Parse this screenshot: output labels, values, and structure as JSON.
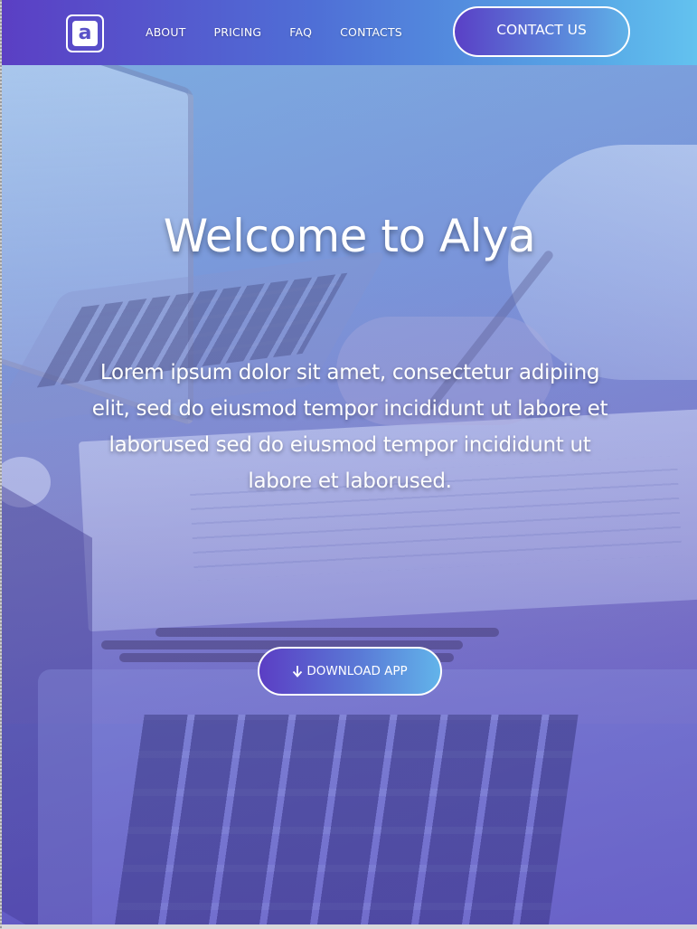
{
  "navbar": {
    "logo_letter": "a",
    "links": [
      {
        "label": "ABOUT"
      },
      {
        "label": "PRICING"
      },
      {
        "label": "FAQ"
      },
      {
        "label": "CONTACTS"
      }
    ],
    "contact_button": "CONTACT US"
  },
  "hero": {
    "title": "Welcome to Alya",
    "text": "Lorem ipsum dolor sit amet, consectetur adipiing elit, sed do eiusmod tempor incididunt ut labore et laborused sed do eiusmod tempor incididunt ut labore et laborused.",
    "download_button": "DOWNLOAD APP",
    "download_icon": "arrow-down-icon"
  },
  "colors": {
    "nav_gradient_start": "#5b3fc4",
    "nav_gradient_end": "#63c2ef",
    "text": "#ffffff"
  }
}
